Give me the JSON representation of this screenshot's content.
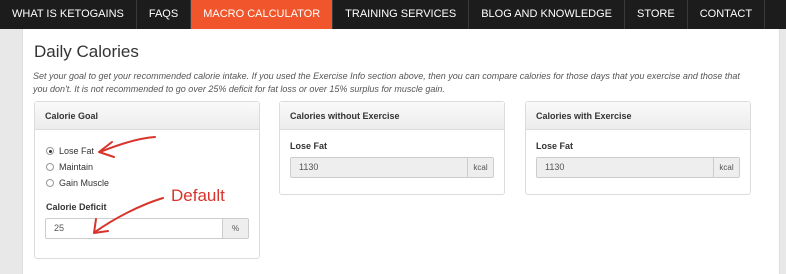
{
  "nav": {
    "items": [
      {
        "label": "WHAT IS KETOGAINS"
      },
      {
        "label": "FAQS"
      },
      {
        "label": "MACRO CALCULATOR"
      },
      {
        "label": "TRAINING SERVICES"
      },
      {
        "label": "BLOG AND KNOWLEDGE"
      },
      {
        "label": "STORE"
      },
      {
        "label": "CONTACT"
      }
    ],
    "active_index": 2,
    "active_color": "#f0552b"
  },
  "section": {
    "title": "Daily Calories",
    "description_line1": "Set your goal to get your recommended calorie intake. If you used the Exercise Info section above, then you can compare calories for those days that you exercise and those that",
    "description_line2": "you don't. It is not recommended to go over 25% deficit for fat loss or over 15% surplus for muscle gain."
  },
  "calorie_goal": {
    "header": "Calorie Goal",
    "options": [
      "Lose Fat",
      "Maintain",
      "Gain Muscle"
    ],
    "selected": "Lose Fat",
    "deficit_label": "Calorie Deficit",
    "deficit_value": "25",
    "deficit_unit": "%"
  },
  "without_exercise": {
    "header": "Calories without Exercise",
    "goal_label": "Lose Fat",
    "value": "1130",
    "unit": "kcal"
  },
  "with_exercise": {
    "header": "Calories with Exercise",
    "goal_label": "Lose Fat",
    "value": "1130",
    "unit": "kcal"
  },
  "annotation": {
    "text": "Default",
    "color": "#d9342b"
  }
}
